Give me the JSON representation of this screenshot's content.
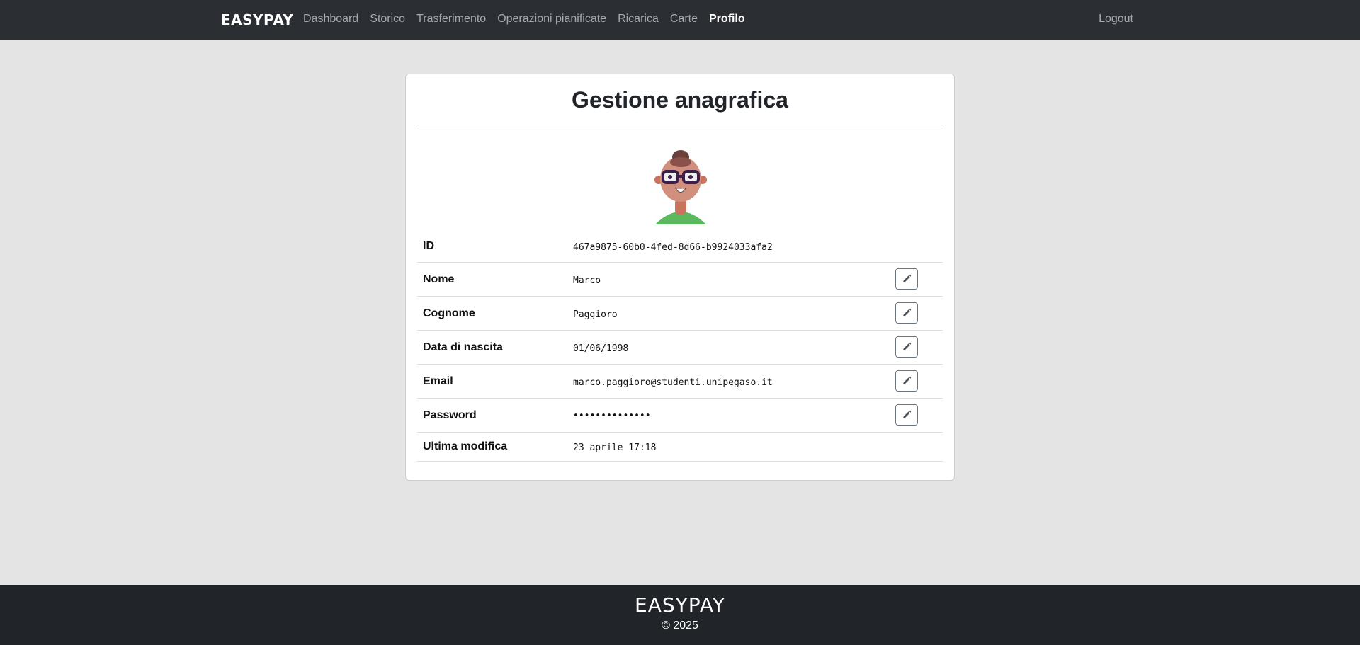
{
  "nav": {
    "brand": "EASYPAY",
    "links": [
      {
        "label": "Dashboard"
      },
      {
        "label": "Storico"
      },
      {
        "label": "Trasferimento"
      },
      {
        "label": "Operazioni pianificate"
      },
      {
        "label": "Ricarica"
      },
      {
        "label": "Carte"
      },
      {
        "label": "Profilo",
        "active": true
      }
    ],
    "logout": "Logout"
  },
  "card": {
    "title": "Gestione anagrafica",
    "avatar_icon": "avatar-glasses-icon",
    "rows": [
      {
        "label": "ID",
        "value": "467a9875-60b0-4fed-8d66-b9924033afa2",
        "editable": false
      },
      {
        "label": "Nome",
        "value": "Marco",
        "editable": true
      },
      {
        "label": "Cognome",
        "value": "Paggioro",
        "editable": true
      },
      {
        "label": "Data di nascita",
        "value": "01/06/1998",
        "editable": true
      },
      {
        "label": "Email",
        "value": "marco.paggioro@studenti.unipegaso.it",
        "editable": true
      },
      {
        "label": "Password",
        "value": "••••••••••••••",
        "editable": true
      },
      {
        "label": "Ultima modifica",
        "value": "23 aprile 17:18",
        "editable": false
      }
    ],
    "edit_icon": "pencil-icon"
  },
  "footer": {
    "brand": "EASYPAY",
    "copyright": "© 2025"
  },
  "colors": {
    "navbar_bg": "#2b2f33",
    "footer_bg": "#212529",
    "page_bg": "#e4e4e4",
    "nav_link": "#a6aaae",
    "nav_active": "#ffffff"
  }
}
